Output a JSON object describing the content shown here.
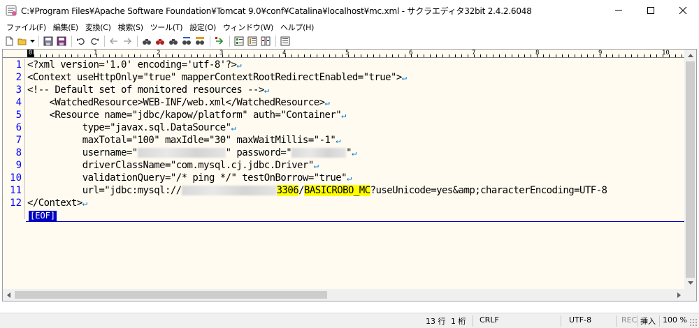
{
  "window": {
    "title": "C:¥Program Files¥Apache Software Foundation¥Tomcat 9.0¥conf¥Catalina¥localhost¥mc.xml - サクラエディタ32bit 2.4.2.6048",
    "minimize": "—",
    "maximize": "☐",
    "close": "✕"
  },
  "menu": [
    "ファイル(F)",
    "編集(E)",
    "変換(C)",
    "検索(S)",
    "ツール(T)",
    "設定(O)",
    "ウィンドウ(W)",
    "ヘルプ(H)"
  ],
  "ruler": {
    "marks": [
      "1",
      "2",
      "3",
      "4",
      "5",
      "6",
      "7",
      "8",
      "9",
      "10"
    ],
    "cursor": "0"
  },
  "editor": {
    "line_numbers": [
      "1",
      "2",
      "3",
      "4",
      "5",
      "6",
      "7",
      "8",
      "9",
      "10",
      "11",
      "12"
    ],
    "lines": [
      {
        "pre": "<?xml version='1.0' encoding='utf-8'?>"
      },
      {
        "pre": "<Context useHttpOnly=\"true\" mapperContextRootRedirectEnabled=\"true\">"
      },
      {
        "pre": "<!-- Default set of monitored resources -->"
      },
      {
        "pre": "    <WatchedResource>WEB-INF/web.xml</WatchedResource>"
      },
      {
        "pre": "    <Resource name=\"jdbc/kapow/platform\" auth=\"Container\""
      },
      {
        "pre": "          type=\"javax.sql.DataSource\""
      },
      {
        "pre": "          maxTotal=\"100\" maxIdle=\"30\" maxWaitMillis=\"-1\""
      },
      {
        "pre": "          username=\"",
        "mid": "\" password=\"",
        "post": "\""
      },
      {
        "pre": "          driverClassName=\"com.mysql.cj.jdbc.Driver\""
      },
      {
        "pre": "          validationQuery=\"/* ping */\" testOnBorrow=\"true\""
      },
      {
        "pre": "          url=\"jdbc:mysql://",
        "hl1": "3306",
        "slash": "/",
        "hl2": "BASICROBO_MC",
        "post": "?useUnicode=yes&amp;characterEncoding=UTF-8"
      },
      {
        "pre": "</Context>"
      }
    ],
    "newline_mark": "↵",
    "eof": "[EOF]"
  },
  "status": {
    "position_line": "13 行",
    "position_col": "1 桁",
    "eol": "CRLF",
    "encoding": "UTF-8",
    "rec": "REC",
    "insert": "挿入",
    "zoom": "100 %"
  },
  "colors": {
    "editor_bg": "#fffbf0",
    "line_number": "#0000ff",
    "newline_mark": "#0078d4",
    "highlight": "#ffff00",
    "eof_bg": "#0000c0"
  }
}
